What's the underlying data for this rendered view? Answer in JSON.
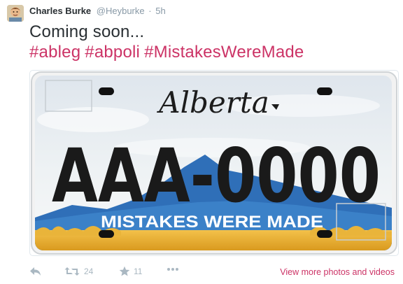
{
  "tweet": {
    "author_name": "Charles Burke",
    "handle": "@Heyburke",
    "separator": "·",
    "time": "5h",
    "text_line1": "Coming soon...",
    "hashtags": [
      "#ableg",
      "#abpoli",
      "#MistakesWereMade"
    ]
  },
  "media": {
    "plate_province": "Alberta",
    "plate_number": "AAA-0000",
    "plate_slogan": "MISTAKES WERE MADE"
  },
  "actions": {
    "reply_icon": "reply-icon",
    "retweet_icon": "retweet-icon",
    "retweet_count": "24",
    "favorite_icon": "star-icon",
    "favorite_count": "11",
    "more_icon": "more-dots-icon",
    "view_more": "View more photos and videos"
  },
  "colors": {
    "hashtag": "#cc3366",
    "meta_gray": "#8899a6",
    "text": "#292f33",
    "icon_gray": "#aab8c2"
  }
}
